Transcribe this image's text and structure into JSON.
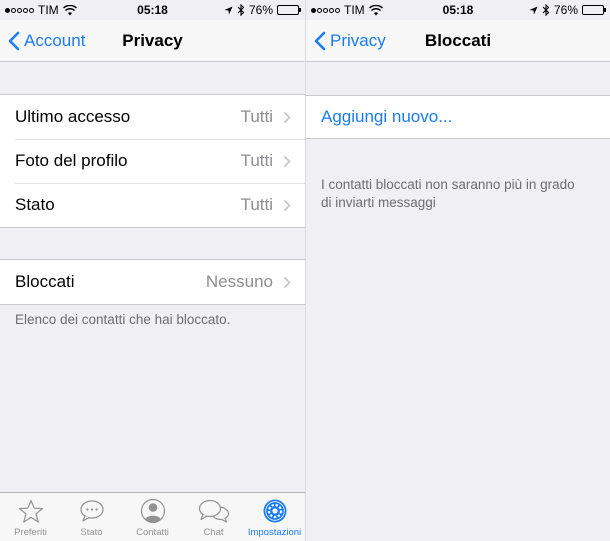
{
  "status_bar": {
    "carrier": "TIM",
    "time": "05:18",
    "battery": "76%",
    "battery_level": 0.76
  },
  "left_screen": {
    "nav": {
      "back_label": "Account",
      "title": "Privacy"
    },
    "rows": [
      {
        "label": "Ultimo accesso",
        "value": "Tutti"
      },
      {
        "label": "Foto del profilo",
        "value": "Tutti"
      },
      {
        "label": "Stato",
        "value": "Tutti"
      }
    ],
    "blocked_row": {
      "label": "Bloccati",
      "value": "Nessuno"
    },
    "blocked_note": "Elenco dei contatti che hai bloccato.",
    "tabs": [
      {
        "label": "Preferiti",
        "icon": "star-icon"
      },
      {
        "label": "Stato",
        "icon": "speech-bubble-icon"
      },
      {
        "label": "Contatti",
        "icon": "person-icon"
      },
      {
        "label": "Chat",
        "icon": "chat-bubbles-icon"
      },
      {
        "label": "Impostazioni",
        "icon": "gear-icon",
        "active": true
      }
    ]
  },
  "right_screen": {
    "nav": {
      "back_label": "Privacy",
      "title": "Bloccati"
    },
    "add_new": "Aggiungi nuovo...",
    "note": "I contatti bloccati non saranno più in grado di inviarti messaggi"
  },
  "colors": {
    "accent": "#1a7cf5",
    "background": "#efeff4",
    "secondary_text": "#8e8e93"
  }
}
